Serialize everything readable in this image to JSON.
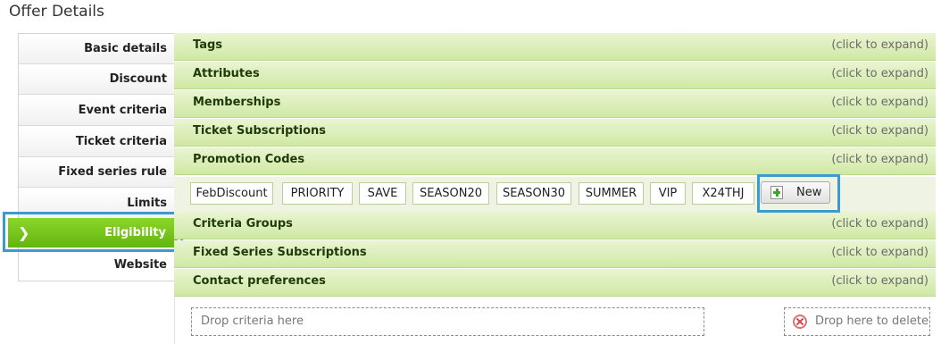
{
  "page": {
    "title": "Offer Details"
  },
  "sidebar": {
    "items": [
      {
        "label": "Basic details"
      },
      {
        "label": "Discount"
      },
      {
        "label": "Event criteria"
      },
      {
        "label": "Ticket criteria"
      },
      {
        "label": "Fixed series rule"
      },
      {
        "label": "Limits"
      },
      {
        "label": "Eligibility",
        "active": true
      },
      {
        "label": "Website"
      }
    ],
    "active_icon": "chevron-right-icon",
    "active_color": "#6fbf17"
  },
  "sections": [
    {
      "title": "Tags",
      "hint": "(click to expand)"
    },
    {
      "title": "Attributes",
      "hint": "(click to expand)"
    },
    {
      "title": "Memberships",
      "hint": "(click to expand)"
    },
    {
      "title": "Ticket Subscriptions",
      "hint": "(click to expand)"
    },
    {
      "title": "Promotion Codes",
      "hint": "(click to expand)"
    },
    {
      "title": "Criteria Groups",
      "hint": "(click to expand)"
    },
    {
      "title": "Fixed Series Subscriptions",
      "hint": "(click to expand)"
    },
    {
      "title": "Contact preferences",
      "hint": "(click to expand)"
    }
  ],
  "promotion_codes": {
    "codes": [
      "FebDiscount",
      "PRIORITY",
      "SAVE",
      "SEASON20",
      "SEASON30",
      "SUMMER",
      "VIP",
      "X24THJ"
    ],
    "new_button": {
      "label": "New",
      "icon": "add-icon"
    }
  },
  "drop_zones": {
    "criteria": "Drop criteria here",
    "delete": "Drop here to delete",
    "delete_icon": "delete-icon"
  },
  "highlight_color": "#3d9ad1"
}
